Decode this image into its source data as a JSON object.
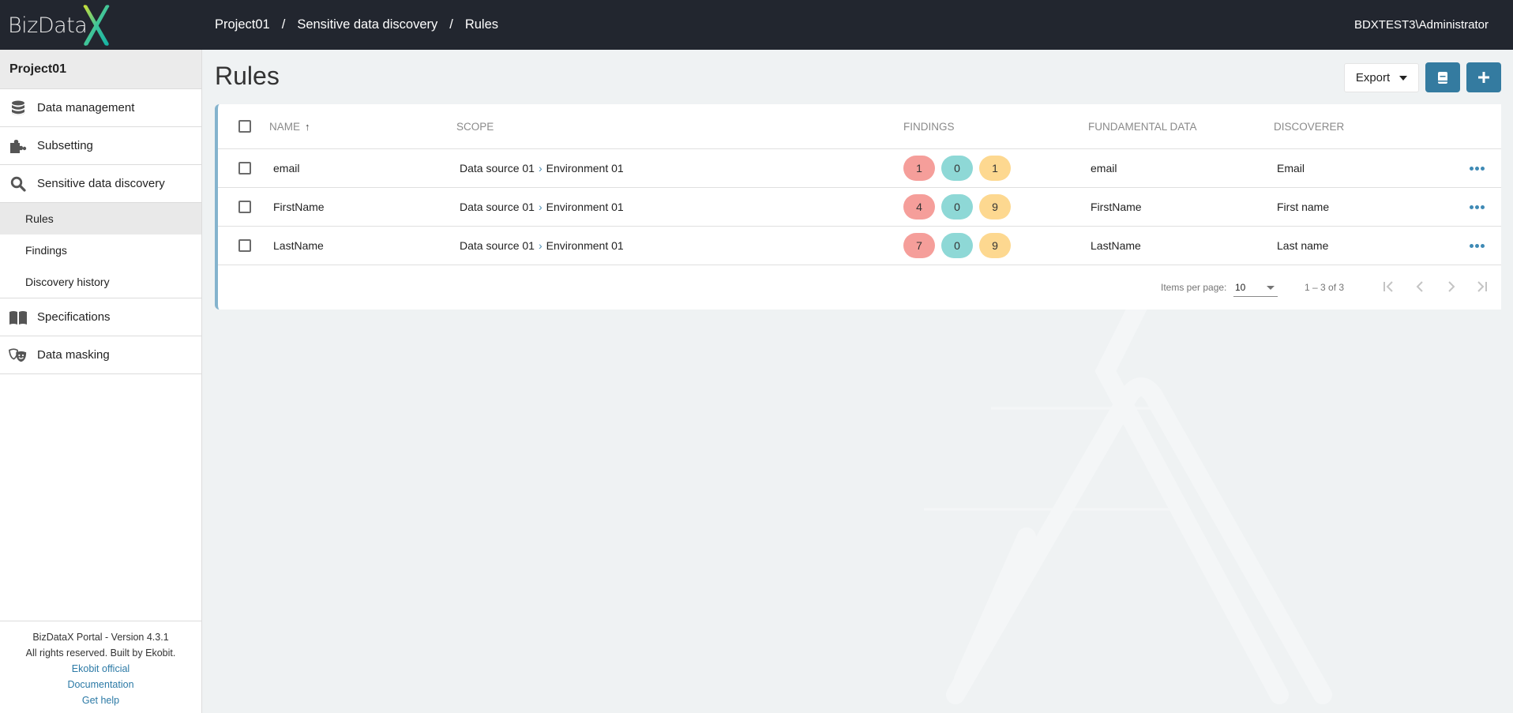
{
  "app": {
    "logo_text": "BizData",
    "logo_accent": "X",
    "user": "BDXTEST3\\Administrator"
  },
  "breadcrumb": [
    {
      "label": "Project01"
    },
    {
      "label": "Sensitive data discovery"
    },
    {
      "label": "Rules"
    }
  ],
  "breadcrumb_separator": "/",
  "sidebar": {
    "project": "Project01",
    "items": [
      {
        "label": "Data management",
        "icon": "database-icon"
      },
      {
        "label": "Subsetting",
        "icon": "puzzle-icon"
      },
      {
        "label": "Sensitive data discovery",
        "icon": "search-icon"
      },
      {
        "label": "Specifications",
        "icon": "book-open-icon"
      },
      {
        "label": "Data masking",
        "icon": "theater-masks-icon"
      }
    ],
    "sub_items": [
      {
        "label": "Rules",
        "active": true
      },
      {
        "label": "Findings",
        "active": false
      },
      {
        "label": "Discovery history",
        "active": false
      }
    ],
    "footer": {
      "version": "BizDataX Portal - Version 4.3.1",
      "rights": "All rights reserved. Built by Ekobit.",
      "links": [
        "Ekobit official",
        "Documentation",
        "Get help"
      ]
    }
  },
  "page": {
    "title": "Rules",
    "export_label": "Export",
    "book_button_icon": "book-icon",
    "add_button_icon": "plus-icon"
  },
  "table": {
    "columns": {
      "name": "NAME",
      "scope": "SCOPE",
      "findings": "FINDINGS",
      "fundamental_data": "FUNDAMENTAL DATA",
      "discoverer": "DISCOVERER"
    },
    "sort": {
      "column": "name",
      "direction": "asc"
    },
    "rows": [
      {
        "name": "email",
        "scope_source": "Data source 01",
        "scope_env": "Environment 01",
        "findings": [
          1,
          0,
          1
        ],
        "fundamental_data": "email",
        "discoverer": "Email"
      },
      {
        "name": "FirstName",
        "scope_source": "Data source 01",
        "scope_env": "Environment 01",
        "findings": [
          4,
          0,
          9
        ],
        "fundamental_data": "FirstName",
        "discoverer": "First name"
      },
      {
        "name": "LastName",
        "scope_source": "Data source 01",
        "scope_env": "Environment 01",
        "findings": [
          7,
          0,
          9
        ],
        "fundamental_data": "LastName",
        "discoverer": "Last name"
      }
    ],
    "finding_colors": [
      "#f59e9a",
      "#8ed8d6",
      "#fdd890"
    ]
  },
  "paginator": {
    "items_per_page_label": "Items per page:",
    "items_per_page": "10",
    "range": "1 – 3 of 3"
  }
}
